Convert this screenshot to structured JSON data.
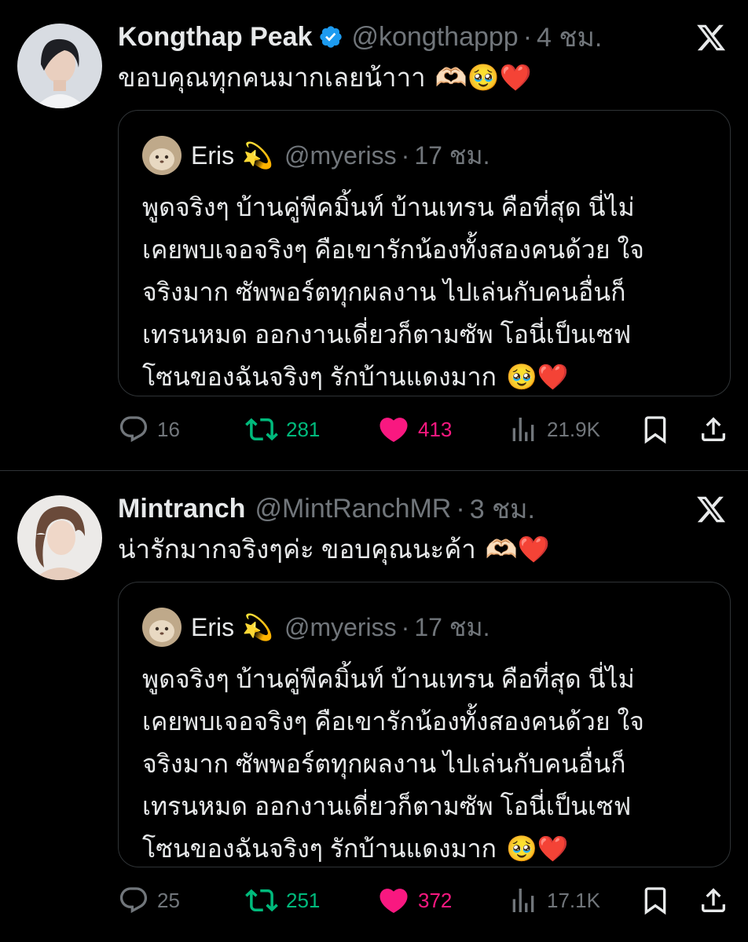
{
  "tweets": [
    {
      "name": "Kongthap Peak",
      "verified": true,
      "handle": "@kongthappp",
      "time": "4 ชม.",
      "text": "ขอบคุณทุกคนมากเลยน้าาา",
      "text_emojis": "🫶🏻🥹❤️",
      "quote": {
        "name": "Eris",
        "name_emoji": "💫",
        "handle": "@myeriss",
        "time": "17 ชม.",
        "lines": [
          "พูดจริงๆ บ้านคู่พีคมิ้นท์ บ้านเทรน คือที่สุด นี่ไม่",
          "เคยพบเจอจริงๆ คือเขารักน้องทั้งสองคนด้วย ใจ",
          "จริงมาก ซัพพอร์ตทุกผลงาน ไปเล่นกับคนอื่นก็",
          "เทรนหมด ออกงานเดี่ยวก็ตามซัพ โอนี่เป็นเซฟ",
          "โซนของฉันจริงๆ รักบ้านแดงมาก"
        ],
        "end_emojis": "🥹❤️"
      },
      "stats": {
        "replies": "16",
        "retweets": "281",
        "likes": "413",
        "views": "21.9K"
      }
    },
    {
      "name": "Mintranch",
      "verified": false,
      "handle": "@MintRanchMR",
      "time": "3 ชม.",
      "text": "น่ารักมากจริงๆค่ะ ขอบคุณนะค้า",
      "text_emojis": "🫶🏻❤️",
      "quote": {
        "name": "Eris",
        "name_emoji": "💫",
        "handle": "@myeriss",
        "time": "17 ชม.",
        "lines": [
          "พูดจริงๆ บ้านคู่พีคมิ้นท์ บ้านเทรน คือที่สุด นี่ไม่",
          "เคยพบเจอจริงๆ คือเขารักน้องทั้งสองคนด้วย ใจ",
          "จริงมาก ซัพพอร์ตทุกผลงาน ไปเล่นกับคนอื่นก็",
          "เทรนหมด ออกงานเดี่ยวก็ตามซัพ โอนี่เป็นเซฟ",
          "โซนของฉันจริงๆ รักบ้านแดงมาก"
        ],
        "end_emojis": "🥹❤️"
      },
      "stats": {
        "replies": "25",
        "retweets": "251",
        "likes": "372",
        "views": "17.1K"
      }
    }
  ],
  "separator": "·",
  "colors": {
    "background": "#000000",
    "text": "#e7e9ea",
    "muted": "#71767b",
    "border": "#2f3336",
    "retweet": "#00ba7c",
    "like": "#f91880",
    "verified": "#1d9bf0"
  },
  "icons": [
    "x-logo-icon",
    "verified-badge-icon",
    "reply-icon",
    "retweet-icon",
    "like-icon",
    "views-icon",
    "bookmark-icon",
    "share-icon"
  ]
}
